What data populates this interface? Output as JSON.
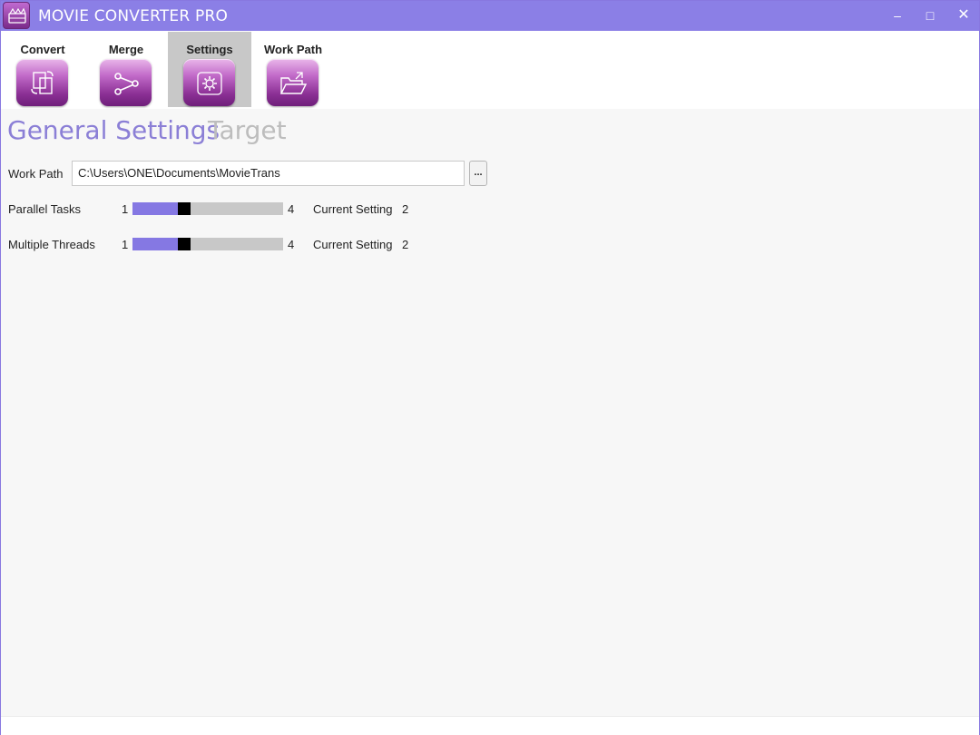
{
  "window": {
    "title": "MOVIE CONVERTER PRO",
    "accent_color": "#8b7fe6",
    "minimize_glyph": "–",
    "maximize_glyph": "□",
    "close_glyph": "✕"
  },
  "toolbar": {
    "items": [
      {
        "label": "Convert",
        "icon": "convert-icon",
        "active": false
      },
      {
        "label": "Merge",
        "icon": "merge-icon",
        "active": false
      },
      {
        "label": "Settings",
        "icon": "gear-icon",
        "active": true
      },
      {
        "label": "Work Path",
        "icon": "folder-icon",
        "active": false
      }
    ]
  },
  "tabs": {
    "general": "General Settings",
    "target": "Target"
  },
  "settings": {
    "work_path": {
      "label": "Work Path",
      "value": "C:\\Users\\ONE\\Documents\\MovieTrans",
      "browse_label": "..."
    },
    "parallel_tasks": {
      "label": "Parallel Tasks",
      "min": "1",
      "max": "4",
      "current_label": "Current Setting",
      "current_value": "2",
      "level": 2
    },
    "multiple_threads": {
      "label": "Multiple Threads",
      "min": "1",
      "max": "4",
      "current_label": "Current Setting",
      "current_value": "2",
      "level": 2
    }
  }
}
